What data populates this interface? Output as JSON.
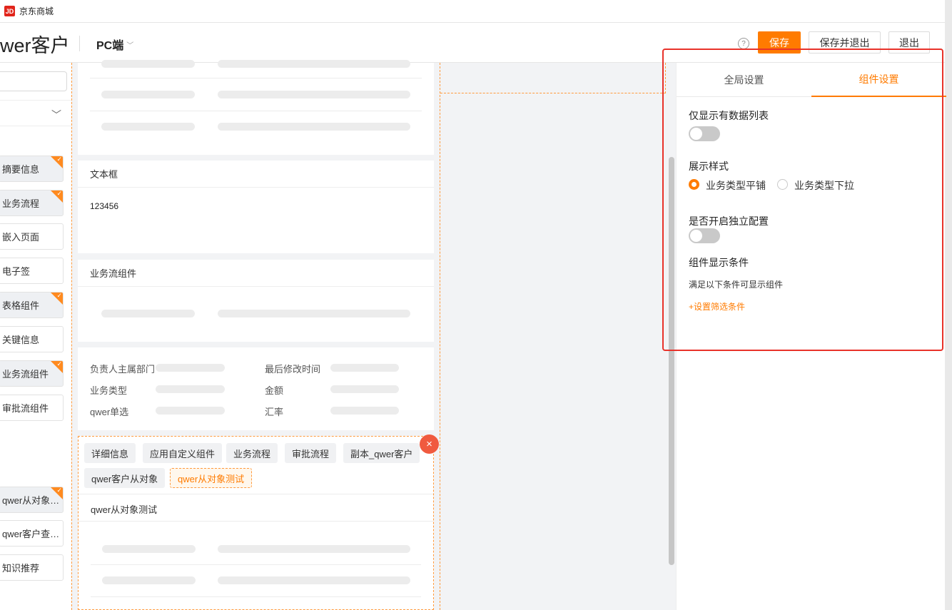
{
  "window": {
    "logo": "JD",
    "title": "京东商城"
  },
  "header": {
    "title": "wer客户",
    "platform": "PC端",
    "help": "?",
    "save": "保存",
    "save_exit": "保存并退出",
    "exit": "退出"
  },
  "sidebar": {
    "items": [
      {
        "label": "摘要信息",
        "used": true
      },
      {
        "label": "业务流程",
        "used": true
      },
      {
        "label": "嵌入页面",
        "used": false
      },
      {
        "label": "电子签",
        "used": false
      },
      {
        "label": "表格组件",
        "used": true
      },
      {
        "label": "关键信息",
        "used": false
      },
      {
        "label": "业务流组件",
        "used": true
      },
      {
        "label": "审批流组件",
        "used": false
      },
      {
        "label": "qwer从对象…",
        "used": true
      },
      {
        "label": "qwer客户查…",
        "used": false
      },
      {
        "label": "知识推荐",
        "used": false
      }
    ]
  },
  "canvas": {
    "textbox": {
      "title": "文本框",
      "value": "123456"
    },
    "flow": {
      "title": "业务流组件"
    },
    "keyinfo": {
      "fields": [
        "负责人主属部门",
        "最后修改时间",
        "业务类型",
        "金额",
        "qwer单选",
        "汇率"
      ]
    },
    "tabs": {
      "chips": [
        "详细信息",
        "应用自定义组件",
        "业务流程",
        "审批流程",
        "副本_qwer客户",
        "qwer客户从对象",
        "qwer从对象测试"
      ],
      "active_index": 6,
      "section_title": "qwer从对象测试",
      "delete": "×"
    }
  },
  "panel": {
    "tabs": [
      "全局设置",
      "组件设置"
    ],
    "active_tab": 1,
    "only_data_label": "仅显示有数据列表",
    "style_label": "展示样式",
    "style_options": [
      "业务类型平铺",
      "业务类型下拉"
    ],
    "style_selected": 0,
    "independent_label": "是否开启独立配置",
    "condition_title": "组件显示条件",
    "condition_desc": "满足以下条件可显示组件",
    "add_filter": "+设置筛选条件"
  }
}
